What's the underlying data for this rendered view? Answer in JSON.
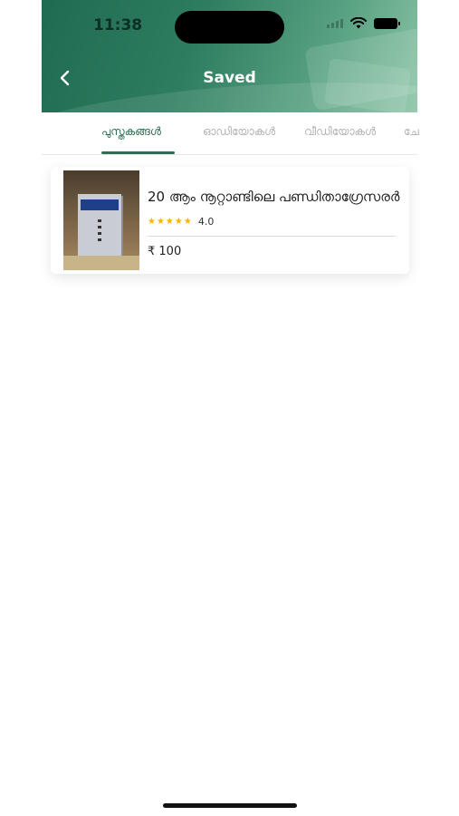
{
  "status_bar": {
    "time": "11:38"
  },
  "header": {
    "title": "Saved"
  },
  "tabs": [
    {
      "label": "പുസ്തകങ്ങൾ",
      "active": true
    },
    {
      "label": "ഓഡിയോകൾ",
      "active": false
    },
    {
      "label": "വീഡിയോകൾ",
      "active": false
    },
    {
      "label": "ചേ",
      "active": false
    }
  ],
  "saved_items": [
    {
      "title": "20 ആം നൂറ്റാണ്ടിലെ പണ്ഡിതാഗ്രേസരർ",
      "stars": "★★★★★",
      "rating": "4.0",
      "price": "₹ 100"
    }
  ],
  "colors": {
    "accent": "#2e6e54",
    "star": "#f7b500",
    "header_start": "#1f6b52",
    "header_end": "#8cc4a6"
  },
  "icons": [
    "back-chevron-icon",
    "wifi-icon",
    "battery-icon",
    "signal-icon",
    "star-icon"
  ]
}
